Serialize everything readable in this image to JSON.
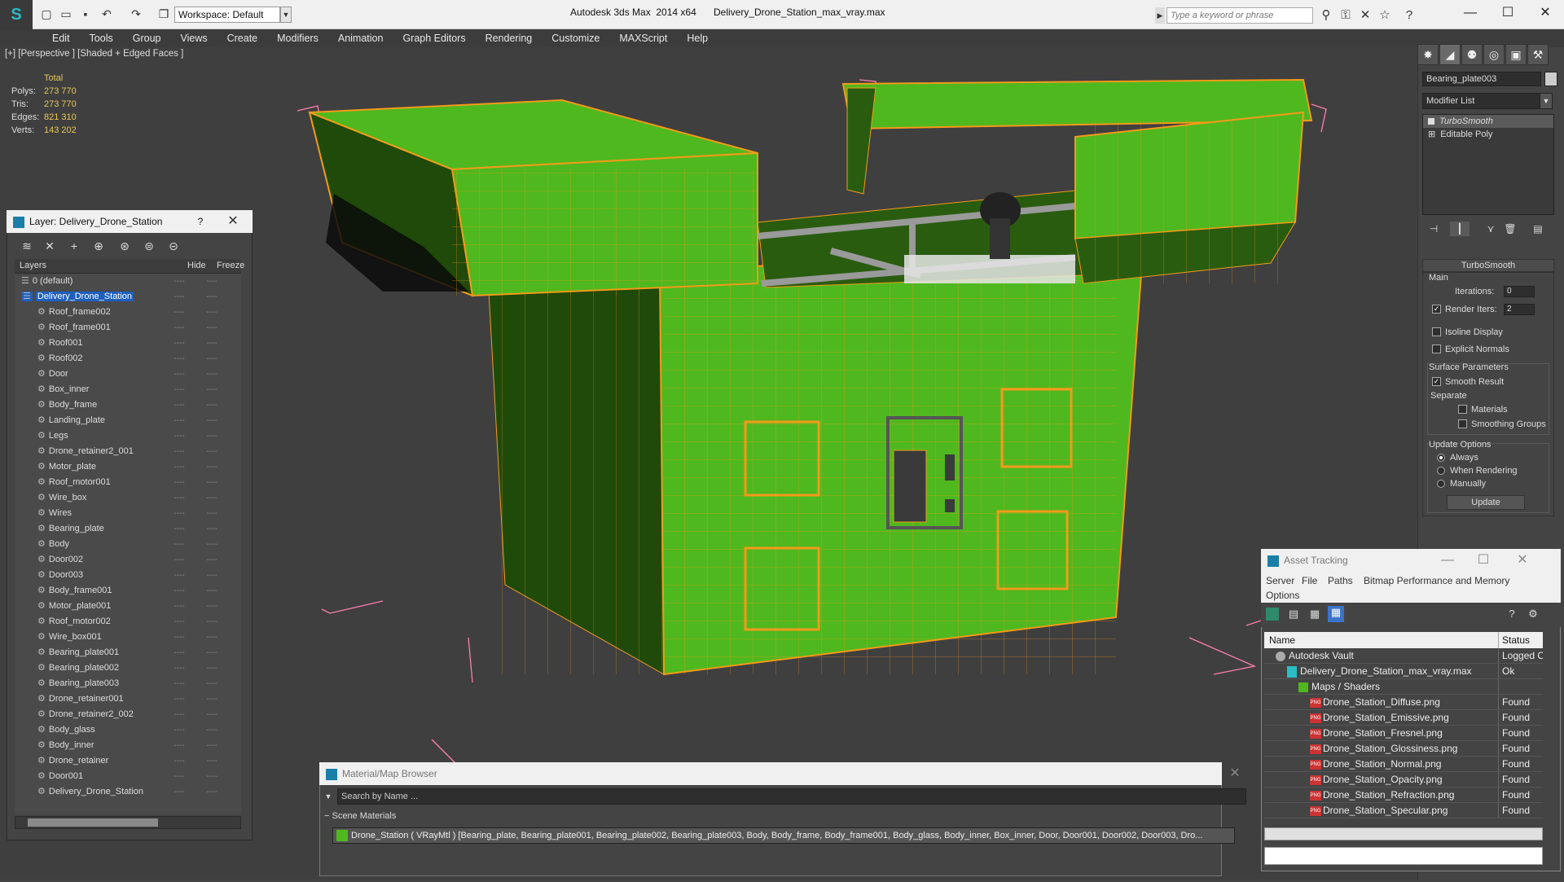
{
  "titlebar": {
    "app_title": "Autodesk 3ds Max  2014 x64",
    "file_title": "Delivery_Drone_Station_max_vray.max",
    "workspace": "Workspace: Default",
    "search_placeholder": "Type a keyword or phrase"
  },
  "menubar": [
    "Edit",
    "Tools",
    "Group",
    "Views",
    "Create",
    "Modifiers",
    "Animation",
    "Graph Editors",
    "Rendering",
    "Customize",
    "MAXScript",
    "Help"
  ],
  "viewport": {
    "label": "[+] [Perspective ] [Shaded + Edged Faces ]",
    "stats_header": "Total",
    "stats": [
      {
        "k": "Polys:",
        "v": "273 770"
      },
      {
        "k": "Tris:",
        "v": "273 770"
      },
      {
        "k": "Edges:",
        "v": "821 310"
      },
      {
        "k": "Verts:",
        "v": "143 202"
      }
    ],
    "colors": {
      "mesh_green": "#4fb81e",
      "mesh_dark": "#1f4a0a",
      "wire": "#f39a1a",
      "bbox": "#ff7fb0"
    }
  },
  "command_panel": {
    "object_name": "Bearing_plate003",
    "modifier_list": "Modifier List",
    "stack": [
      "TurboSmooth",
      "Editable Poly"
    ],
    "turbosmooth": {
      "title": "TurboSmooth",
      "main": "Main",
      "iterations_label": "Iterations:",
      "iterations": "0",
      "render_iters_label": "Render Iters:",
      "render_iters": "2",
      "isoline": "Isoline Display",
      "explicit": "Explicit Normals",
      "surface_params": "Surface Parameters",
      "smooth_result": "Smooth Result",
      "separate": "Separate",
      "materials": "Materials",
      "smoothing_groups": "Smoothing Groups",
      "update_options": "Update Options",
      "always": "Always",
      "when_rendering": "When Rendering",
      "manually": "Manually",
      "update": "Update"
    }
  },
  "layer_window": {
    "title": "Layer: Delivery_Drone_Station",
    "help": "?",
    "col_layers": "Layers",
    "col_hide": "Hide",
    "col_freeze": "Freeze",
    "dash": "----",
    "layers": [
      {
        "name": "0 (default)",
        "level": 0
      },
      {
        "name": "Delivery_Drone_Station",
        "level": 0,
        "selected": true
      },
      {
        "name": "Roof_frame002",
        "level": 1
      },
      {
        "name": "Roof_frame001",
        "level": 1
      },
      {
        "name": "Roof001",
        "level": 1
      },
      {
        "name": "Roof002",
        "level": 1
      },
      {
        "name": "Door",
        "level": 1
      },
      {
        "name": "Box_inner",
        "level": 1
      },
      {
        "name": "Body_frame",
        "level": 1
      },
      {
        "name": "Landing_plate",
        "level": 1
      },
      {
        "name": "Legs",
        "level": 1
      },
      {
        "name": "Drone_retainer2_001",
        "level": 1
      },
      {
        "name": "Motor_plate",
        "level": 1
      },
      {
        "name": "Roof_motor001",
        "level": 1
      },
      {
        "name": "Wire_box",
        "level": 1
      },
      {
        "name": "Wires",
        "level": 1
      },
      {
        "name": "Bearing_plate",
        "level": 1
      },
      {
        "name": "Body",
        "level": 1
      },
      {
        "name": "Door002",
        "level": 1
      },
      {
        "name": "Door003",
        "level": 1
      },
      {
        "name": "Body_frame001",
        "level": 1
      },
      {
        "name": "Motor_plate001",
        "level": 1
      },
      {
        "name": "Roof_motor002",
        "level": 1
      },
      {
        "name": "Wire_box001",
        "level": 1
      },
      {
        "name": "Bearing_plate001",
        "level": 1
      },
      {
        "name": "Bearing_plate002",
        "level": 1
      },
      {
        "name": "Bearing_plate003",
        "level": 1
      },
      {
        "name": "Drone_retainer001",
        "level": 1
      },
      {
        "name": "Drone_retainer2_002",
        "level": 1
      },
      {
        "name": "Body_glass",
        "level": 1
      },
      {
        "name": "Body_inner",
        "level": 1
      },
      {
        "name": "Drone_retainer",
        "level": 1
      },
      {
        "name": "Door001",
        "level": 1
      },
      {
        "name": "Delivery_Drone_Station",
        "level": 1
      }
    ]
  },
  "asset_tracking": {
    "title": "Asset Tracking",
    "menu": [
      "Server",
      "File",
      "Paths",
      "Bitmap Performance and Memory",
      "Options"
    ],
    "col_name": "Name",
    "col_status": "Status",
    "rows": [
      {
        "name": "Autodesk Vault",
        "status": "Logged O",
        "indent": 1,
        "icon": "vault"
      },
      {
        "name": "Delivery_Drone_Station_max_vray.max",
        "status": "Ok",
        "indent": 2,
        "icon": "max"
      },
      {
        "name": "Maps / Shaders",
        "status": "",
        "indent": 3,
        "icon": "maps"
      },
      {
        "name": "Drone_Station_Diffuse.png",
        "status": "Found",
        "indent": 4,
        "icon": "png"
      },
      {
        "name": "Drone_Station_Emissive.png",
        "status": "Found",
        "indent": 4,
        "icon": "png"
      },
      {
        "name": "Drone_Station_Fresnel.png",
        "status": "Found",
        "indent": 4,
        "icon": "png"
      },
      {
        "name": "Drone_Station_Glossiness.png",
        "status": "Found",
        "indent": 4,
        "icon": "png"
      },
      {
        "name": "Drone_Station_Normal.png",
        "status": "Found",
        "indent": 4,
        "icon": "png"
      },
      {
        "name": "Drone_Station_Opacity.png",
        "status": "Found",
        "indent": 4,
        "icon": "png"
      },
      {
        "name": "Drone_Station_Refraction.png",
        "status": "Found",
        "indent": 4,
        "icon": "png"
      },
      {
        "name": "Drone_Station_Specular.png",
        "status": "Found",
        "indent": 4,
        "icon": "png"
      }
    ]
  },
  "material_browser": {
    "title": "Material/Map Browser",
    "search": "Search by Name ...",
    "section": "Scene Materials",
    "row": "Drone_Station ( VRayMtl ) [Bearing_plate, Bearing_plate001, Bearing_plate002, Bearing_plate003, Body, Body_frame, Body_frame001, Body_glass, Body_inner, Box_inner, Door, Door001, Door002, Door003, Dro..."
  }
}
